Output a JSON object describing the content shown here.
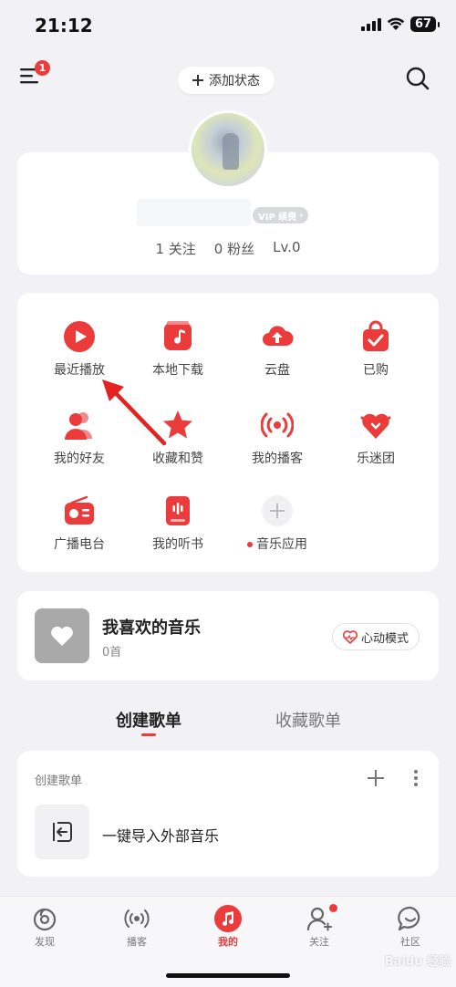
{
  "status_bar": {
    "time": "21:12",
    "battery": "67"
  },
  "header": {
    "menu_badge": "1",
    "status_button": "添加状态"
  },
  "profile": {
    "vip_tag": "VIP 续费",
    "follow": "1 关注",
    "fans": "0 粉丝",
    "level": "Lv.0"
  },
  "grid": [
    {
      "label": "最近播放",
      "icon": "play-circle-icon"
    },
    {
      "label": "本地下载",
      "icon": "music-note-box-icon"
    },
    {
      "label": "云盘",
      "icon": "cloud-upload-icon"
    },
    {
      "label": "已购",
      "icon": "shopping-bag-check-icon"
    },
    {
      "label": "我的好友",
      "icon": "friends-icon"
    },
    {
      "label": "收藏和赞",
      "icon": "star-icon"
    },
    {
      "label": "我的播客",
      "icon": "broadcast-icon"
    },
    {
      "label": "乐迷团",
      "icon": "heart-fan-icon"
    },
    {
      "label": "广播电台",
      "icon": "radio-icon"
    },
    {
      "label": "我的听书",
      "icon": "audiobook-icon"
    },
    {
      "label": "音乐应用",
      "icon": "plus-icon"
    }
  ],
  "favorites": {
    "title": "我喜欢的音乐",
    "count": "0首",
    "mode_button": "心动模式"
  },
  "tabs": {
    "created": "创建歌单",
    "collected": "收藏歌单"
  },
  "playlists": {
    "header": "创建歌单",
    "import_label": "一键导入外部音乐"
  },
  "bottom_nav": [
    {
      "label": "发现",
      "icon": "discover-icon"
    },
    {
      "label": "播客",
      "icon": "podcast-icon"
    },
    {
      "label": "我的",
      "icon": "music-note-icon"
    },
    {
      "label": "关注",
      "icon": "follow-user-icon"
    },
    {
      "label": "社区",
      "icon": "community-chat-icon"
    }
  ],
  "watermark": "Baidu 经验",
  "colors": {
    "accent": "#eb3b3b",
    "background": "#f2f2f6"
  }
}
